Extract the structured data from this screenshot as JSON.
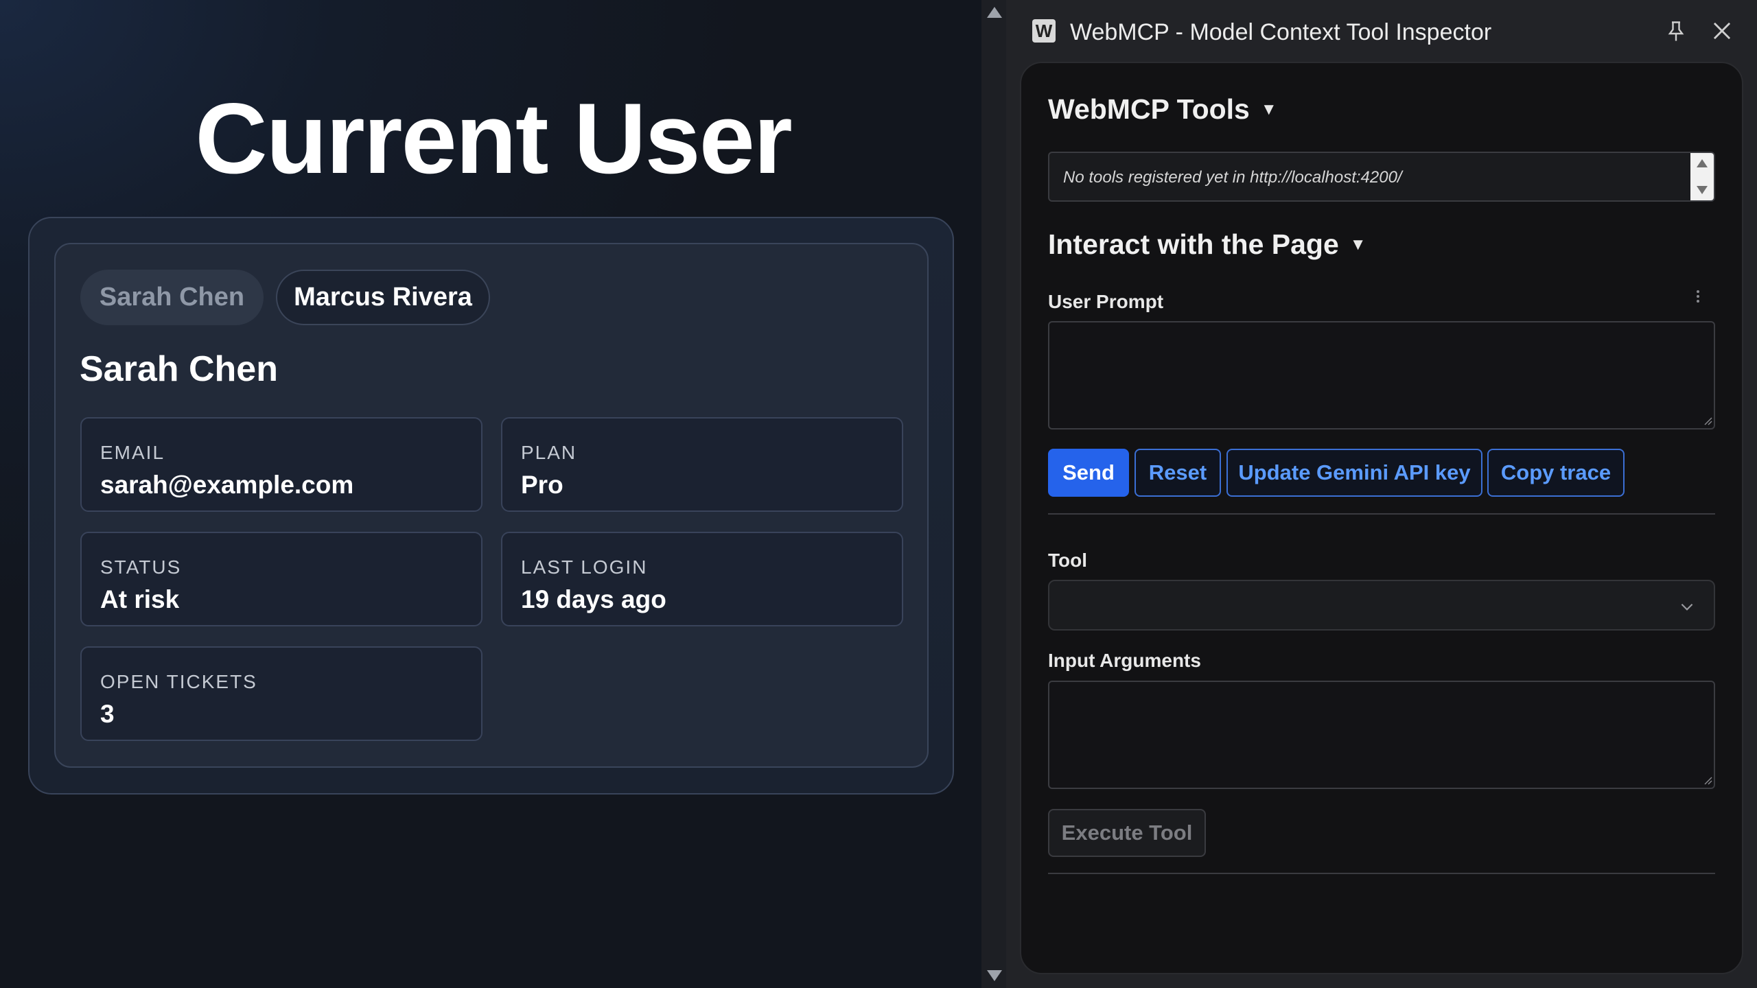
{
  "page": {
    "title": "Current User",
    "user_tabs": [
      {
        "label": "Sarah Chen",
        "active": true
      },
      {
        "label": "Marcus Rivera",
        "active": false
      }
    ],
    "selected_user": {
      "name": "Sarah Chen",
      "fields": [
        {
          "label": "EMAIL",
          "value": "sarah@example.com"
        },
        {
          "label": "PLAN",
          "value": "Pro"
        },
        {
          "label": "STATUS",
          "value": "At risk"
        },
        {
          "label": "LAST LOGIN",
          "value": "19 days ago"
        },
        {
          "label": "OPEN TICKETS",
          "value": "3"
        }
      ]
    }
  },
  "inspector": {
    "app_icon_letter": "W",
    "window_title": "WebMCP - Model Context Tool Inspector",
    "tools_section": {
      "heading": "WebMCP Tools",
      "message": "No tools registered yet in http://localhost:4200/"
    },
    "interact_section": {
      "heading": "Interact with the Page",
      "user_prompt_label": "User Prompt",
      "user_prompt_value": "",
      "buttons": {
        "send": "Send",
        "reset": "Reset",
        "update_key": "Update Gemini API key",
        "copy_trace": "Copy trace"
      },
      "tool_label": "Tool",
      "tool_selected": "",
      "input_args_label": "Input Arguments",
      "input_args_value": "",
      "execute_button": "Execute Tool"
    }
  },
  "colors": {
    "accent": "#2563eb",
    "accent_text": "#5b9bff",
    "panel_bg": "#121214",
    "page_card_bg": "#222a39"
  }
}
